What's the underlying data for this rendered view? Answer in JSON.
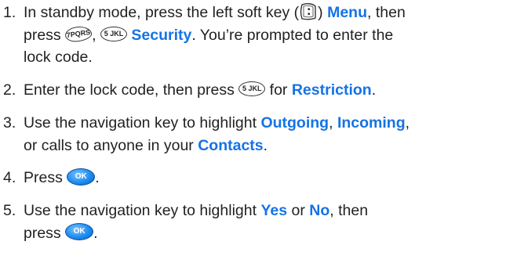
{
  "steps": [
    {
      "number": "1.",
      "text_a": "In standby mode, press the left soft key (",
      "text_b": ") ",
      "kw_menu": "Menu",
      "text_c": ", then",
      "text_d": "press ",
      "key_7": "7PQRS",
      "text_e": ", ",
      "key_5": "5 JKL",
      "text_f": " ",
      "kw_security": "Security",
      "text_g": ". You’re prompted to enter the",
      "text_h": "lock code."
    },
    {
      "number": "2.",
      "text_a": "Enter the lock code, then press ",
      "key_5": "5 JKL",
      "text_b": " for ",
      "kw_restriction": "Restriction",
      "text_c": "."
    },
    {
      "number": "3.",
      "text_a": "Use the navigation key to highlight ",
      "kw_outgoing": "Outgoing",
      "text_b": ", ",
      "kw_incoming": "Incoming",
      "text_c": ",",
      "text_d": "or calls to anyone in your ",
      "kw_contacts": "Contacts",
      "text_e": "."
    },
    {
      "number": "4.",
      "text_a": "Press ",
      "key_ok": "OK",
      "text_b": "."
    },
    {
      "number": "5.",
      "text_a": "Use the navigation key to highlight ",
      "kw_yes": "Yes",
      "text_b": " or ",
      "kw_no": "No",
      "text_c": ", then",
      "text_d": "press ",
      "key_ok": "OK",
      "text_e": "."
    }
  ],
  "colors": {
    "keyword": "#1573e6",
    "text": "#231f20",
    "ok_key": "#1d8cf0"
  },
  "icons": {
    "soft_key": "left-soft-key-icon",
    "key_7": "key-7-icon",
    "key_5": "key-5-icon",
    "key_ok": "ok-key-icon"
  }
}
